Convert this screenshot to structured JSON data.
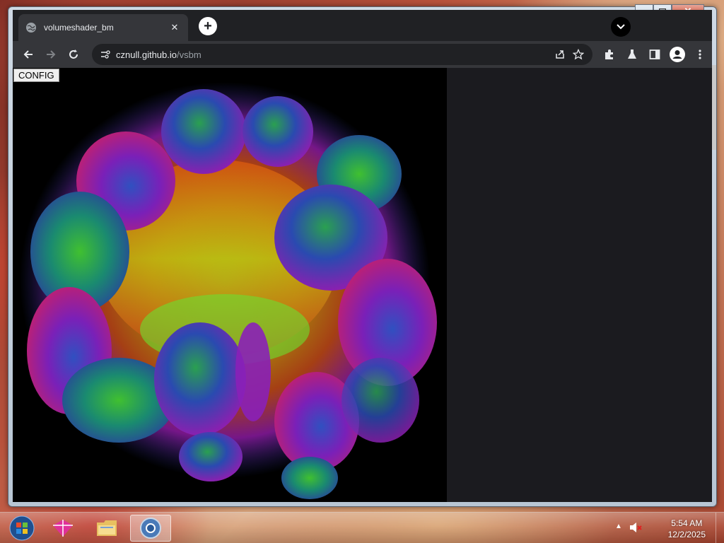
{
  "browser": {
    "tab": {
      "title": "volumeshader_bm",
      "close": "✕"
    },
    "new_tab": "+",
    "close_window": "✕",
    "url": {
      "host": "cznull.github.io",
      "path": "/vsbm"
    }
  },
  "page": {
    "config_button": "CONFIG"
  },
  "taskbar": {
    "time": "5:54 AM",
    "date": "12/2/2025"
  },
  "colors": {
    "chrome_dark": "#202124",
    "chrome_toolbar": "#35363a",
    "page_bg": "#000000"
  }
}
